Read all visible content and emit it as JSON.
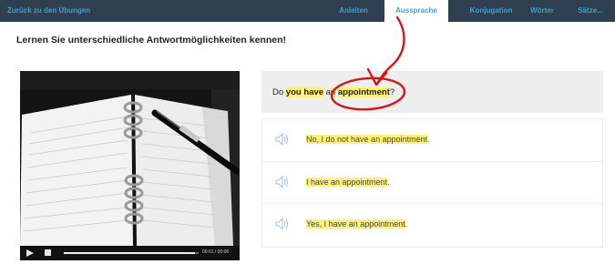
{
  "nav": {
    "back_label": "Zurück zu den Übungen",
    "tabs": [
      {
        "label": "Anleiten",
        "active": false
      },
      {
        "label": "Aussprache",
        "active": true
      },
      {
        "label": "Konjugation",
        "active": false
      },
      {
        "label": "Wörter",
        "active": false
      },
      {
        "label": "Sätze...",
        "active": false
      }
    ]
  },
  "page_title": "Lernen Sie unterschiedliche Antwortmöglichkeiten kennen!",
  "video": {
    "time": "00:01 / 00:06",
    "progress": 0.97
  },
  "question": {
    "prefix": "Do ",
    "hl1": "you have",
    "mid": " a",
    "hl2": "n",
    "space": " ",
    "hl3": "appointment",
    "suffix": "?"
  },
  "answers": [
    {
      "parts": [
        {
          "text": "No, I do ",
          "hl": true
        },
        {
          "text": "not have an appointment",
          "hl": true,
          "strong": true
        },
        {
          "text": ".",
          "hl": false
        }
      ]
    },
    {
      "parts": [
        {
          "text": "I have an appointment",
          "hl": true
        },
        {
          "text": ".",
          "hl": false
        }
      ]
    },
    {
      "parts": [
        {
          "text": "Yes, I have an appointment",
          "hl": true
        },
        {
          "text": ".",
          "hl": false
        }
      ]
    }
  ],
  "colors": {
    "nav_bg": "#2f3f4f",
    "nav_link": "#3aa2d8",
    "highlight": "#fff07a",
    "annotation": "#d01818"
  }
}
